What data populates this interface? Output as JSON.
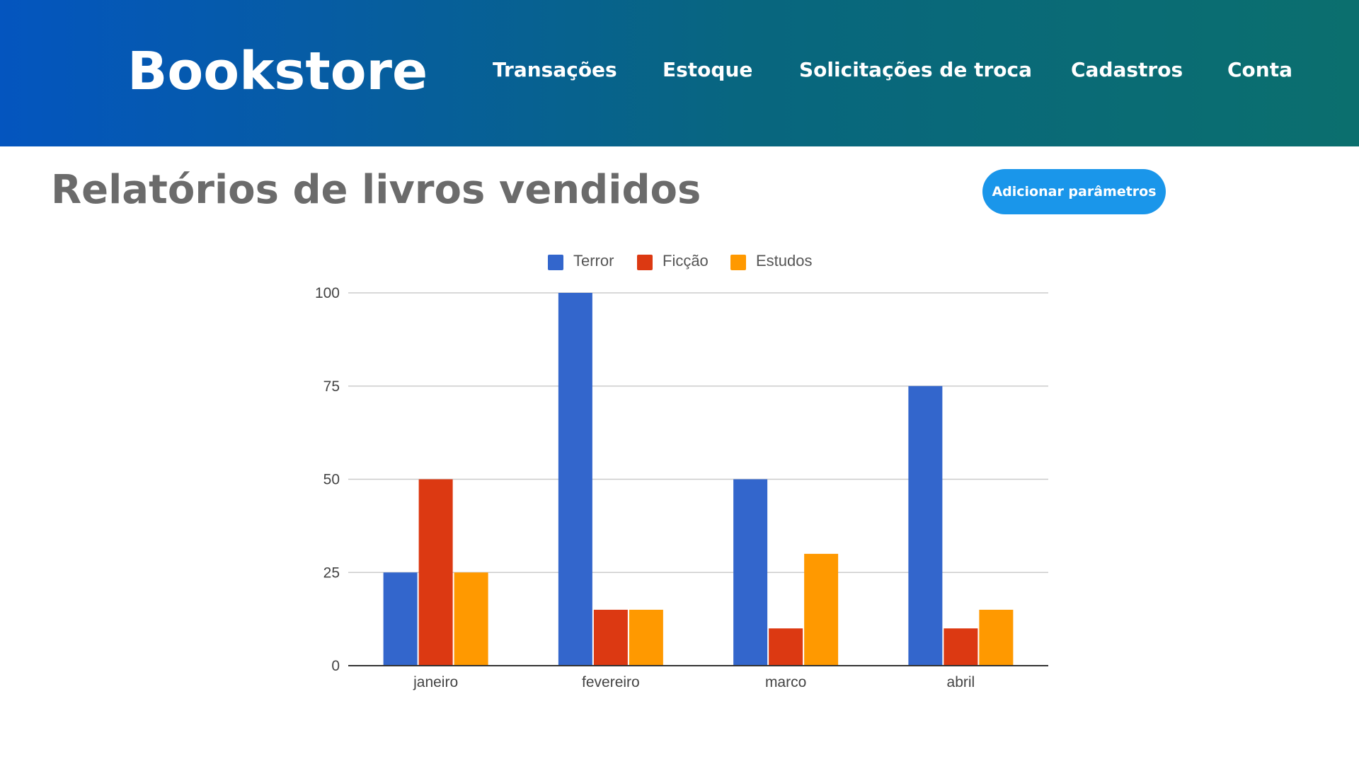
{
  "header": {
    "brand": "Bookstore",
    "nav": [
      "Transações",
      "Estoque",
      "Solicitações de troca",
      "Cadastros",
      "Conta"
    ]
  },
  "main": {
    "title": "Relatórios de livros vendidos",
    "add_button": "Adicionar parâmetros"
  },
  "colors": {
    "header_gradient_start": "#0455bf",
    "header_gradient_end": "#0b6f6e",
    "button": "#1a96ea",
    "terror": "#3366cc",
    "ficcao": "#dc3912",
    "estudos": "#ff9900"
  },
  "chart_data": {
    "type": "bar",
    "categories": [
      "janeiro",
      "fevereiro",
      "marco",
      "abril"
    ],
    "series": [
      {
        "name": "Terror",
        "values": [
          25,
          100,
          50,
          75
        ],
        "color": "#3366cc"
      },
      {
        "name": "Ficção",
        "values": [
          50,
          15,
          10,
          10
        ],
        "color": "#dc3912"
      },
      {
        "name": "Estudos",
        "values": [
          25,
          15,
          30,
          15
        ],
        "color": "#ff9900"
      }
    ],
    "ylim": [
      0,
      100
    ],
    "yticks": [
      0,
      25,
      50,
      75,
      100
    ],
    "grid": true,
    "legend": "top-center"
  }
}
